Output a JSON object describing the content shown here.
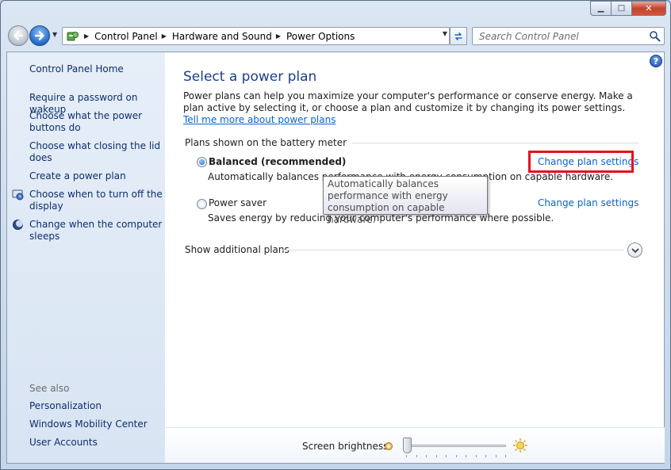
{
  "window": {
    "caption": {
      "minimize": "▁",
      "maximize": "□",
      "close": "✕"
    }
  },
  "address_bar": {
    "breadcrumbs": [
      "Control Panel",
      "Hardware and Sound",
      "Power Options"
    ],
    "icon": "control-panel-icon",
    "search_placeholder": "Search Control Panel"
  },
  "sidebar": {
    "home": "Control Panel Home",
    "tasks": [
      "Require a password on wakeup",
      "Choose what the power buttons do",
      "Choose what closing the lid does",
      "Create a power plan",
      "Choose when to turn off the display",
      "Change when the computer sleeps"
    ],
    "see_also_label": "See also",
    "see_also": [
      "Personalization",
      "Windows Mobility Center",
      "User Accounts"
    ]
  },
  "main": {
    "help": "?",
    "title": "Select a power plan",
    "intro_text": "Power plans can help you maximize your computer's performance or conserve energy. Make a plan active by selecting it, or choose a plan and customize it by changing its power settings. ",
    "intro_link": "Tell me more about power plans",
    "group_label": "Plans shown on the battery meter",
    "plans": [
      {
        "name": "Balanced (recommended)",
        "selected": true,
        "description": "Automatically balances performance with energy consumption on capable hardware.",
        "change_link": "Change plan settings"
      },
      {
        "name": "Power saver",
        "selected": false,
        "description": "Saves energy by reducing your computer's performance where possible.",
        "change_link": "Change plan settings"
      }
    ],
    "tooltip": "Automatically balances performance with energy consumption on capable hardware.",
    "additional_plans": "Show additional plans",
    "brightness_label": "Screen brightness:",
    "brightness_level": 0
  },
  "colors": {
    "accent_highlight": "#e0131e",
    "link": "#0b63c7",
    "title": "#1b3f8a"
  }
}
